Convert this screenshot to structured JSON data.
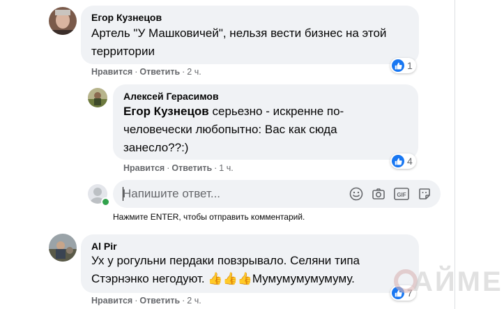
{
  "comments": [
    {
      "author": "Егор Кузнецов",
      "line1": "Артель \"У Машковичей\", нельзя вести бизнес на этой",
      "line2": "территории",
      "like_label": "Нравится",
      "reply_label": "Ответить",
      "time": "2 ч.",
      "reaction_count": "1"
    },
    {
      "author": "Алексей Герасимов",
      "mention": "Егор Кузнецов",
      "line1_rest": " серьезно - искренне по-",
      "line2": "человечески любопытно: Вас как сюда",
      "line3": "занесло??:)",
      "like_label": "Нравится",
      "reply_label": "Ответить",
      "time": "1 ч.",
      "reaction_count": "4"
    },
    {
      "author": "Al Pir",
      "line1": "Ух у рогульни пердаки повзрывало. Селяни типа",
      "line2_start": "Стэрнэнко негодуют. ",
      "emoji": "👍👍👍",
      "line2_end": "Мумумумумумуму.",
      "like_label": "Нравится",
      "reply_label": "Ответить",
      "time": "2 ч.",
      "reaction_count": "7"
    }
  ],
  "reply_box": {
    "placeholder": "Напишите ответ...",
    "hint": "Нажмите ENTER, чтобы отправить комментарий."
  },
  "reaction_icon": "thumbs-up-icon",
  "accent_color": "#1877f2",
  "watermark_text": "АЙМЕР"
}
